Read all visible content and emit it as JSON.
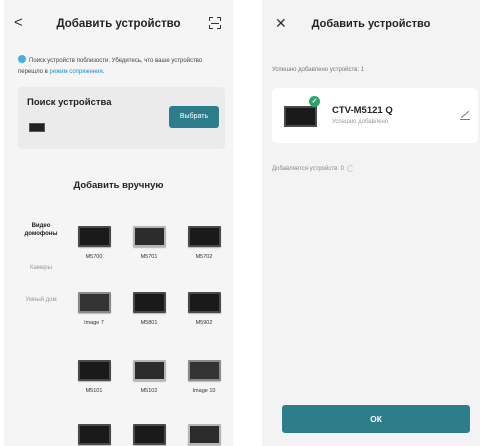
{
  "left": {
    "title": "Добавить устройство",
    "hint_text": "Поиск устройств поблизости. Убедитесь, что ваше устройство перешло в ",
    "hint_link": "режим сопряжения",
    "hint_end": ".",
    "search_title": "Поиск устройства",
    "select_label": "Выбрать",
    "manual_title": "Добавить вручную",
    "categories": [
      "Видео домофоны",
      "Камеры",
      "Умный дом"
    ],
    "devices": [
      {
        "label": "M5700"
      },
      {
        "label": "M5701"
      },
      {
        "label": "M5702"
      },
      {
        "label": "Image 7"
      },
      {
        "label": "M5801"
      },
      {
        "label": "M5902"
      },
      {
        "label": "M5101"
      },
      {
        "label": "M5102"
      },
      {
        "label": "Image 10"
      }
    ]
  },
  "right": {
    "title": "Добавить устройство",
    "added_label": "Успешно добавлено устройств: 1",
    "device_name": "CTV-M5121 Q",
    "device_status": "Успешно добавлено",
    "adding_label": "Добавляется устройств: 0",
    "ok_label": "ОК"
  },
  "colors": {
    "accent": "#2e7d8a",
    "success": "#2ea36b",
    "link": "#1f8fd1"
  },
  "icons": {
    "back": "chevron-left-icon",
    "scan": "scan-icon",
    "close": "close-icon",
    "edit": "edit-icon"
  }
}
